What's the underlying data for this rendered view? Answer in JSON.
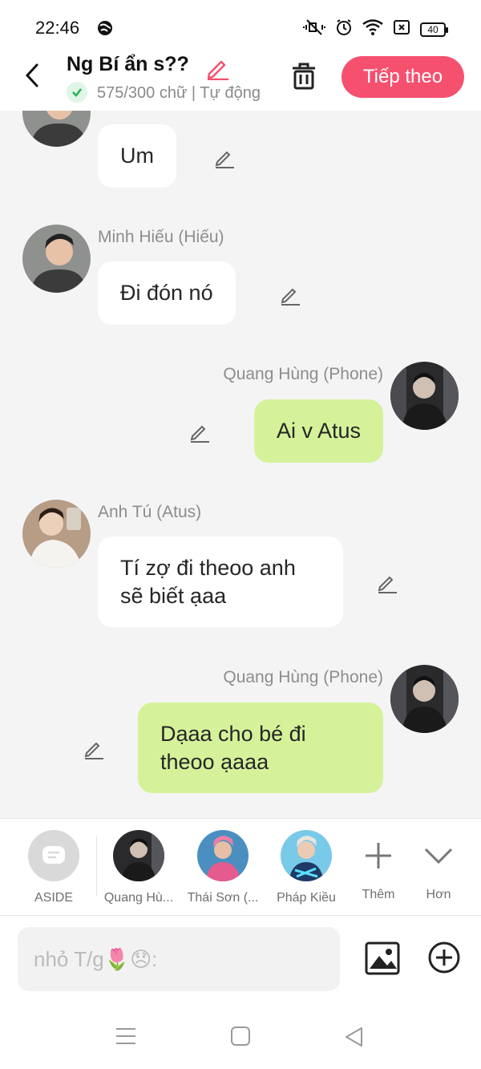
{
  "status_bar": {
    "time": "22:46",
    "battery": "40"
  },
  "header": {
    "title": "Ng Bí ẩn s??",
    "subtitle": "575/300 chữ | Tự động",
    "next_button": "Tiếp theo"
  },
  "messages": [
    {
      "name": "",
      "text": "Um"
    },
    {
      "name": "Minh Hiếu (Hiếu)",
      "text": "Đi đón nó"
    },
    {
      "name": "Quang Hùng (Phone)",
      "text": "Ai v Atus"
    },
    {
      "name": "Anh Tú (Atus)",
      "text": "Tí zợ đi theoo anh sẽ biết ạaa"
    },
    {
      "name": "Quang Hùng (Phone)",
      "text": "Dạaa cho bé đi theoo ạaaa"
    }
  ],
  "characters": [
    {
      "label": "ASIDE"
    },
    {
      "label": "Quang Hù..."
    },
    {
      "label": "Thái Sơn (..."
    },
    {
      "label": "Pháp Kiều"
    },
    {
      "label": "Thêm"
    },
    {
      "label": "Hơn"
    }
  ],
  "input": {
    "placeholder": "nhỏ T/g🌷😞:"
  },
  "colors": {
    "accent": "#f5506e",
    "right_bubble": "#d5f29a",
    "left_bubble": "#ffffff",
    "background": "#f4f4f5"
  }
}
